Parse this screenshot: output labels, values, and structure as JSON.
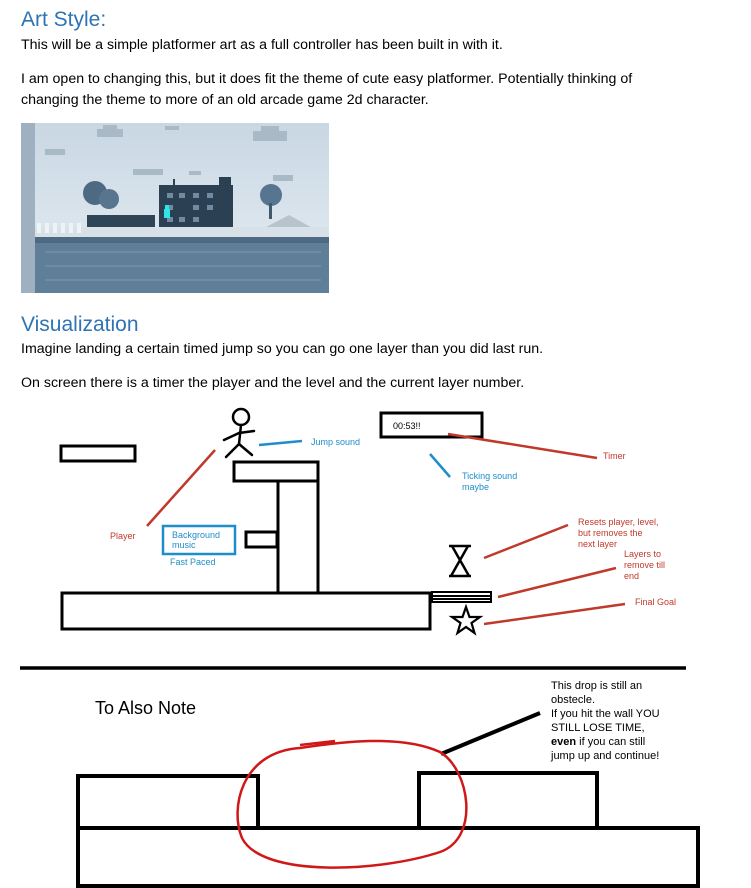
{
  "art_style": {
    "heading": "Art Style:",
    "para1": "This will be a simple platformer art as a full controller has been built in with it.",
    "para2_line1": "I am open to changing this, but it does fit the theme of cute easy platformer. Potentially thinking of",
    "para2_line2": "changing the theme to more of an old arcade game 2d character."
  },
  "visualization": {
    "heading": "Visualization",
    "para1": "Imagine landing a certain timed jump so you can go one layer than you did last run.",
    "para2": "On screen there is a timer the player and the level and the current layer number."
  },
  "sketch": {
    "timer_value": "00:53!!",
    "jump_sound": "Jump sound",
    "timer_label": "Timer",
    "ticking_line1": "Ticking sound",
    "ticking_line2": "maybe",
    "player_label": "Player",
    "background_line1": "Background",
    "background_line2": "music",
    "fast_paced": "Fast Paced",
    "resets_line1": "Resets player, level,",
    "resets_line2": "but removes the",
    "resets_line3": "next layer",
    "layers_line1": "Layers to",
    "layers_line2": "remove till",
    "layers_line3": "end",
    "final_goal": "Final Goal"
  },
  "note": {
    "title": "To Also Note",
    "line1": "This drop is still an",
    "line2": "obstecle.",
    "line3": "If you hit the wall YOU",
    "line4": "STILL LOSE TIME,",
    "line5_bold": "even",
    "line5_rest": " if you can still",
    "line6": "jump up and continue!"
  },
  "colors": {
    "heading": "#2e74b5",
    "annotation_red": "#c0392b",
    "annotation_blue": "#1f8dc9"
  }
}
